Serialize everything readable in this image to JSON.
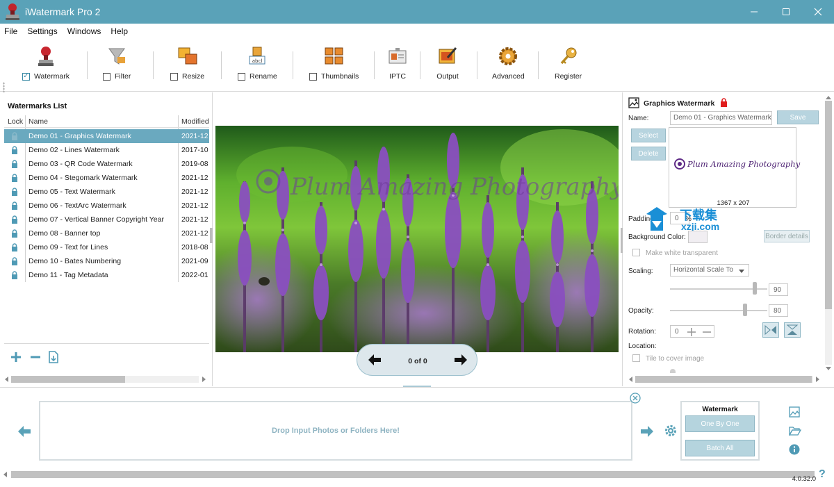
{
  "window": {
    "title": "iWatermark Pro 2"
  },
  "menu": [
    "File",
    "Settings",
    "Windows",
    "Help"
  ],
  "toolbar": {
    "watermark": {
      "label": "Watermark",
      "checked": true
    },
    "filter": {
      "label": "Filter",
      "checked": false
    },
    "resize": {
      "label": "Resize",
      "checked": false
    },
    "rename": {
      "label": "Rename",
      "checked": false
    },
    "thumbnails": {
      "label": "Thumbnails",
      "checked": false
    },
    "iptc": {
      "label": "IPTC"
    },
    "output": {
      "label": "Output"
    },
    "advanced": {
      "label": "Advanced"
    },
    "register": {
      "label": "Register"
    }
  },
  "watermarks_list": {
    "title": "Watermarks List",
    "columns": [
      "Lock",
      "Name",
      "Modified"
    ],
    "rows": [
      {
        "name": "Demo 01 - Graphics Watermark",
        "modified": "2021-12",
        "selected": true
      },
      {
        "name": "Demo 02 - Lines Watermark",
        "modified": "2017-10"
      },
      {
        "name": "Demo 03 - QR Code Watermark",
        "modified": "2019-08"
      },
      {
        "name": "Demo 04 - Stegomark Watermark",
        "modified": "2021-12"
      },
      {
        "name": "Demo 05 - Text Watermark",
        "modified": "2021-12"
      },
      {
        "name": "Demo 06 - TextArc Watermark",
        "modified": "2021-12"
      },
      {
        "name": "Demo 07 - Vertical Banner Copyright Year",
        "modified": "2021-12"
      },
      {
        "name": "Demo 08 - Banner top",
        "modified": "2021-12"
      },
      {
        "name": "Demo 09 - Text for Lines",
        "modified": "2018-08"
      },
      {
        "name": "Demo 10 - Bates Numbering",
        "modified": "2021-09"
      },
      {
        "name": "Demo 11 - Tag Metadata",
        "modified": "2022-01"
      }
    ]
  },
  "preview": {
    "watermark_text": "Plum Amazing Photography",
    "counter": "0 of 0"
  },
  "inspector": {
    "title": "Graphics Watermark",
    "name_label": "Name:",
    "name_value": "Demo 01 - Graphics Watermark",
    "save_label": "Save",
    "select_label": "Select",
    "delete_label": "Delete",
    "graphic_text": "Plum Amazing Photography",
    "graphic_size": "1367 x 207",
    "padding_label": "Padding:",
    "padding_value": "0",
    "padding_unit": "%",
    "bg_color_label": "Background Color:",
    "border_details_label": "Border details",
    "make_white_transparent": "Make white transparent",
    "scaling_label": "Scaling:",
    "scaling_value": "Horizontal Scale To",
    "scaling_amount": "90",
    "opacity_label": "Opacity:",
    "opacity_value": "80",
    "rotation_label": "Rotation:",
    "rotation_value": "0",
    "location_label": "Location:",
    "tile_label": "Tile to cover image",
    "overlay_badge": "下载集",
    "overlay_site": "xzji.com"
  },
  "bottom": {
    "dropzone_text": "Drop Input Photos or Folders Here!",
    "mode_title": "Watermark",
    "one_by_one": "One By One",
    "batch_all": "Batch All",
    "version": "4.0.32.0"
  },
  "colors": {
    "accent": "#5aa2b8",
    "selection": "#6aa9bf",
    "button": "#b5d4de"
  }
}
